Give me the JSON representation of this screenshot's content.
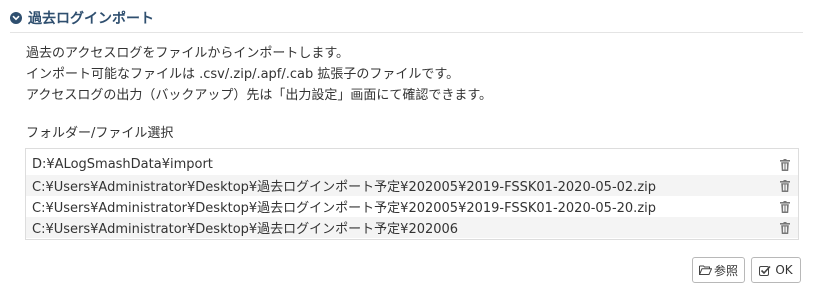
{
  "header": {
    "title": "過去ログインポート",
    "collapse_icon": "chevron-down-circle-icon"
  },
  "description": {
    "line1": "過去のアクセスログをファイルからインポートします。",
    "line2": "インポート可能なファイルは .csv/.zip/.apf/.cab 拡張子のファイルです。",
    "line3": "アクセスログの出力（バックアップ）先は「出力設定」画面にて確認できます。"
  },
  "selection": {
    "label": "フォルダー/ファイル選択",
    "items": [
      {
        "path": "D:¥ALogSmashData¥import",
        "delete_icon": "trash-icon"
      },
      {
        "path": "C:¥Users¥Administrator¥Desktop¥過去ログインポート予定¥202005¥2019-FSSK01-2020-05-02.zip",
        "delete_icon": "trash-icon"
      },
      {
        "path": "C:¥Users¥Administrator¥Desktop¥過去ログインポート予定¥202005¥2019-FSSK01-2020-05-20.zip",
        "delete_icon": "trash-icon"
      },
      {
        "path": "C:¥Users¥Administrator¥Desktop¥過去ログインポート予定¥202006",
        "delete_icon": "trash-icon"
      }
    ]
  },
  "buttons": {
    "browse_label": "参照",
    "browse_icon": "folder-open-icon",
    "ok_label": "OK",
    "ok_icon": "checkbox-icon"
  },
  "colors": {
    "title": "#2f4f6f",
    "text": "#333333",
    "row_alt": "#f4f4f4",
    "border": "#dddddd"
  }
}
